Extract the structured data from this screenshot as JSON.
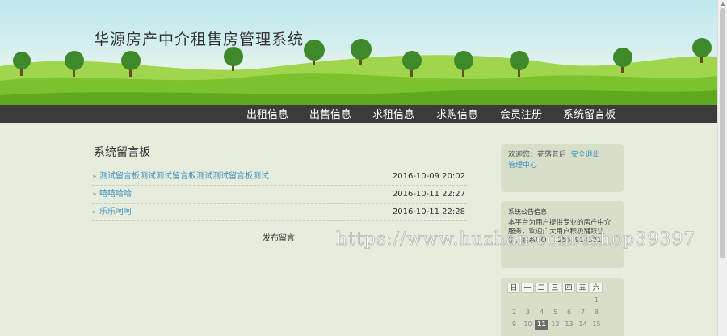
{
  "site": {
    "title": "华源房产中介租售房管理系统"
  },
  "nav": {
    "items": [
      "出租信息",
      "出售信息",
      "求租信息",
      "求购信息",
      "会员注册",
      "系统留言板"
    ]
  },
  "board": {
    "title": "系统留言板",
    "messages": [
      {
        "title": "测试留言板测试测试留言板测试测试留言板测试",
        "date": "2016-10-09 20:02"
      },
      {
        "title": "嘻嘻哈哈",
        "date": "2016-10-11 22:27"
      },
      {
        "title": "乐乐呵呵",
        "date": "2016-10-11 22:28"
      }
    ],
    "post_label": "发布留言"
  },
  "sidebar": {
    "login": {
      "welcome": "欢迎您：",
      "user": "花落昔后",
      "logout": "安全退出",
      "member_center": "管理中心"
    },
    "notice": {
      "title": "系统公告信息",
      "body": "本平台为用户提供专业的房产中介服务，欢迎广大用户积极踊跃注册，联系QQ：12557914301"
    },
    "calendar": {
      "weekdays": [
        "日",
        "一",
        "二",
        "三",
        "四",
        "五",
        "六"
      ],
      "week1": [
        "",
        "",
        "",
        "",
        "",
        "",
        "1"
      ],
      "week2": [
        "2",
        "3",
        "4",
        "5",
        "6",
        "7",
        "8"
      ],
      "week3": [
        "9",
        "10",
        "11",
        "12",
        "13",
        "14",
        "15"
      ],
      "today": "11"
    }
  },
  "watermark": {
    "text": "https://www.huzhan.com/ishop39397"
  },
  "colors": {
    "nav_bg": "#3b3b39",
    "link": "#3a8fc4",
    "page_bg": "#e6eddc",
    "sidebar_box": "#d8dfc9"
  }
}
